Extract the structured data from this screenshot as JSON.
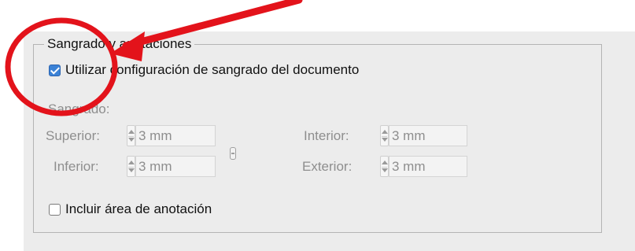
{
  "group": {
    "title": "Sangrado y anotaciones"
  },
  "use_document_bleed": {
    "label": "Utilizar configuración de sangrado del documento",
    "checked": true
  },
  "bleed": {
    "section_label": "Sangrado:",
    "superior": {
      "label": "Superior:",
      "value": "3 mm"
    },
    "inferior": {
      "label": "Inferior:",
      "value": "3 mm"
    },
    "interior": {
      "label": "Interior:",
      "value": "3 mm"
    },
    "exterior": {
      "label": "Exterior:",
      "value": "3 mm"
    },
    "link_icon": "chain-link-icon"
  },
  "include_slug": {
    "label": "Incluir área de anotación",
    "checked": false
  },
  "annotation": {
    "color": "#e3131b",
    "shapes": [
      "circle",
      "arrow"
    ]
  }
}
